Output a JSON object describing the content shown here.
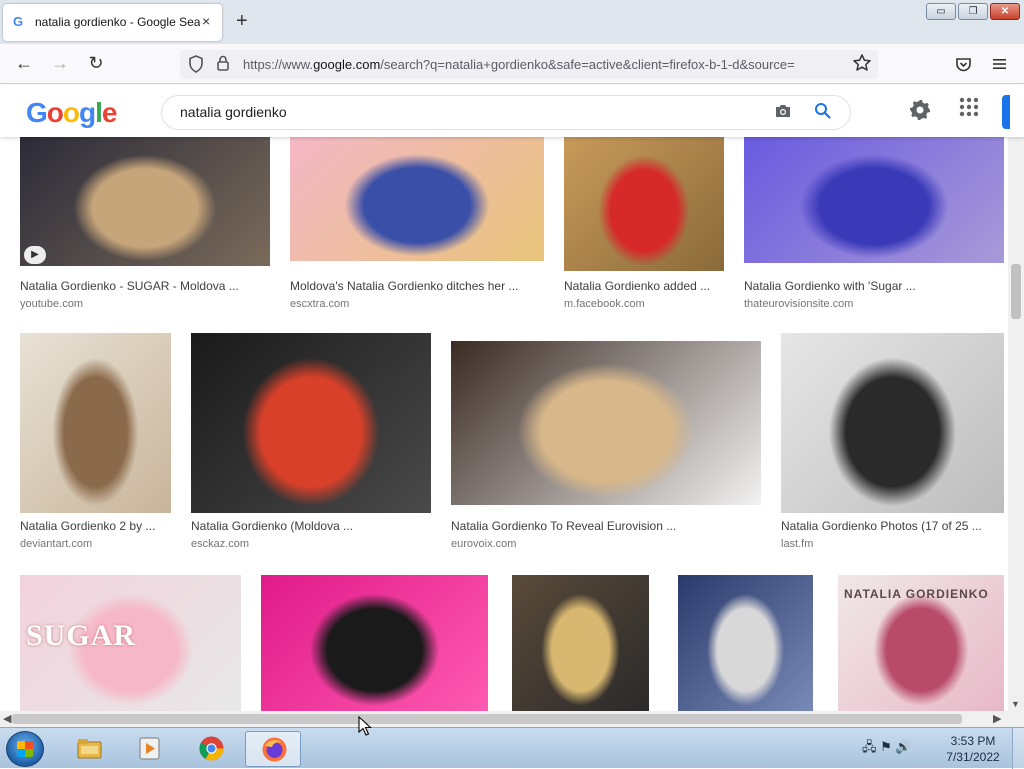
{
  "browser": {
    "tab_title": "natalia gordienko - Google Search",
    "tab_favicon": "G",
    "tab_close": "×",
    "new_tab": "+",
    "window_controls": {
      "minimize": "▭",
      "maximize": "❐",
      "close": "✕"
    },
    "nav": {
      "back": "←",
      "forward": "→",
      "reload": "↻"
    },
    "url_prefix": "https://www.",
    "url_domain": "google.com",
    "url_rest": "/search?q=natalia+gordienko&safe=active&client=firefox-b-1-d&source=",
    "icons": {
      "shield": "shield-icon",
      "lock": "lock-icon",
      "star": "star-icon",
      "pocket": "pocket-icon",
      "menu": "hamburger-menu-icon"
    }
  },
  "google": {
    "logo_letters": [
      "G",
      "o",
      "o",
      "g",
      "l",
      "e"
    ],
    "logo_colors": [
      "#4285f4",
      "#ea4335",
      "#fbbc05",
      "#4285f4",
      "#34a853",
      "#ea4335"
    ],
    "search_query": "natalia gordienko",
    "accent": "#1a73e8"
  },
  "results": [
    {
      "caption": "Natalia Gordienko - SUGAR - Moldova ...",
      "source": "youtube.com",
      "palette": [
        "#2b2b38",
        "#c6a57a",
        "#7a6a5a"
      ],
      "video": true
    },
    {
      "caption": "Moldova's Natalia Gordienko ditches her ...",
      "source": "escxtra.com",
      "palette": [
        "#f4b7c6",
        "#3a4fa8",
        "#e8c47a"
      ]
    },
    {
      "caption": "Natalia Gordienko added ...",
      "source": "m.facebook.com",
      "palette": [
        "#c89a5a",
        "#d62a2a",
        "#8a6a3a"
      ]
    },
    {
      "caption": "Natalia Gordienko with 'Sugar ...",
      "source": "thateurovisionsite.com",
      "palette": [
        "#6a5ae0",
        "#3a3ab8",
        "#a89ad8"
      ]
    },
    {
      "caption": "Natalia Gordienko 2 by ...",
      "source": "deviantart.com",
      "palette": [
        "#e8e2d6",
        "#8a6a4a",
        "#c8b49a"
      ]
    },
    {
      "caption": "Natalia Gordienko (Moldova ...",
      "source": "esckaz.com",
      "palette": [
        "#1a1a1a",
        "#d8402a",
        "#4a4a4a"
      ]
    },
    {
      "caption": "Natalia Gordienko To Reveal Eurovision ...",
      "source": "eurovoix.com",
      "palette": [
        "#3a2a22",
        "#d8b88a",
        "#f2f2f2"
      ]
    },
    {
      "caption": "Natalia Gordienko Photos (17 of 25 ...",
      "source": "last.fm",
      "palette": [
        "#e6e6e6",
        "#2a2a2a",
        "#bdbdbd"
      ]
    },
    {
      "palette": [
        "#f2d2dc",
        "#f6b8c8",
        "#e8e8e8"
      ],
      "overlay": "SUGAR"
    },
    {
      "palette": [
        "#e01a8a",
        "#1a1a1a",
        "#ff5ab0"
      ]
    },
    {
      "palette": [
        "#5a4a3a",
        "#d8b870",
        "#2a2a2a"
      ]
    },
    {
      "palette": [
        "#2a3a6a",
        "#d8d8d8",
        "#7a8ab8"
      ]
    },
    {
      "palette": [
        "#f0e8e6",
        "#b84a6a",
        "#e8b8c8"
      ],
      "overlay": "NATALIA GORDIENKO"
    }
  ],
  "scrollbars": {
    "up": "▲",
    "down": "▼",
    "left": "◀",
    "right": "▶"
  },
  "taskbar": {
    "apps": [
      "file-explorer-icon",
      "media-player-icon",
      "chrome-icon",
      "firefox-icon"
    ],
    "clock_time": "3:53 PM",
    "clock_date": "7/31/2022",
    "tray_glyphs": "🖧 ⚑ 🔊"
  }
}
